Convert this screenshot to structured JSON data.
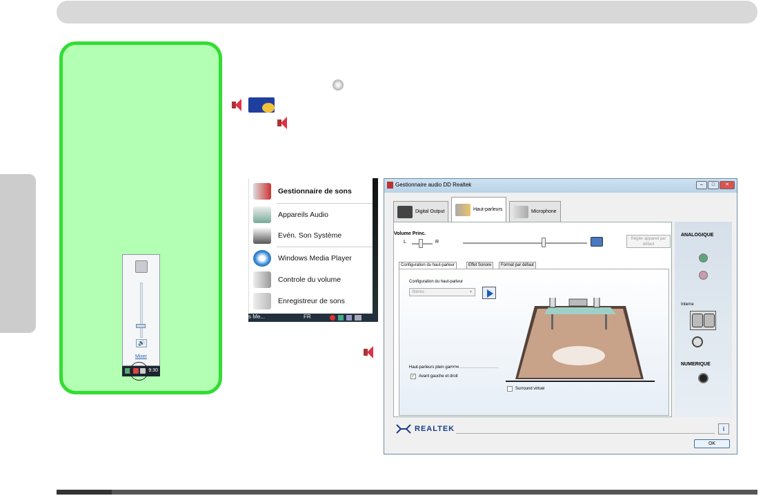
{
  "start_menu": {
    "items": [
      {
        "label": "Gestionnaire de sons",
        "icon": "speaker-icon"
      },
      {
        "label": "Appareils Audio",
        "icon": "audio-devices-icon"
      },
      {
        "label": "Evén. Son Système",
        "icon": "system-sound-icon"
      },
      {
        "label": "Windows Media Player",
        "icon": "media-player-icon"
      },
      {
        "label": "Controle du volume",
        "icon": "volume-control-icon"
      },
      {
        "label": "Enregistreur de sons",
        "icon": "sound-recorder-icon"
      }
    ],
    "taskbar_left": "s Me...",
    "taskbar_lang": "FR"
  },
  "volume_popup": {
    "mixer_label": "Mixer",
    "clock": "9:30"
  },
  "window": {
    "title": "Gestionnaire audio DD Realtek",
    "tabs": [
      "Digital Output",
      "Haut-parleurs",
      "Microphone"
    ],
    "active_tab": "Haut-parleurs",
    "volume_label": "Volume Princ.",
    "left_label": "L",
    "right_label": "R",
    "default_button": "Régler appareil par défaut",
    "subtabs": [
      "Configuration du haut-parleur",
      "Effet Sonore",
      "Format par défaut"
    ],
    "config_group_label": "Configuration du haut-parleur",
    "config_select_value": "Stéréo",
    "fullrange_label": "Haut-parleurs plein gamme",
    "front_checkbox_label": "Avant gauche et droit",
    "surround_label": "Surround virtuel",
    "right_panel": {
      "analog_heading": "ANALOGIQUE",
      "internal_label": "Interne",
      "digital_heading": "NUMERIQUE"
    },
    "brand": "REALTEK",
    "ok_button": "OK",
    "info_button": "i"
  },
  "colors": {
    "note_fill": "#b3ffb3",
    "note_border": "#33dd33",
    "floor": "#c8a289",
    "floor_edge": "#55433a"
  }
}
